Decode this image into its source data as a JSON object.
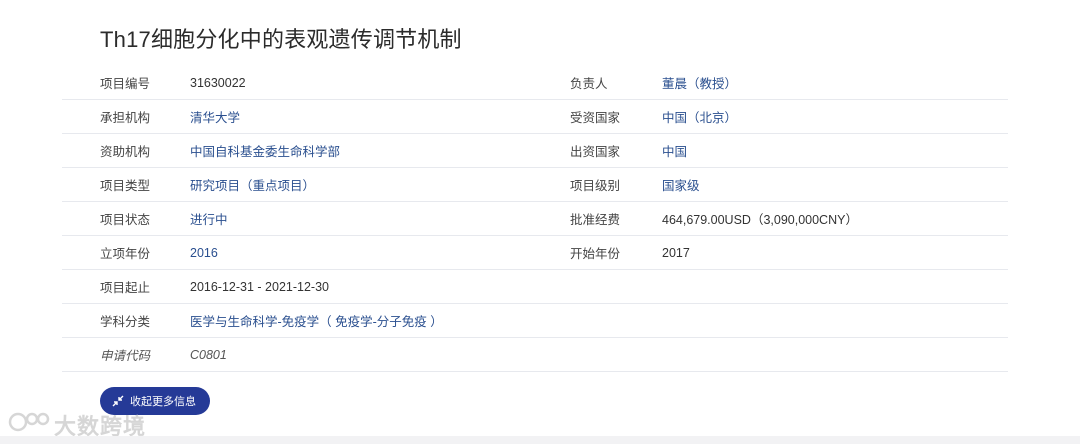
{
  "title": "Th17细胞分化中的表观遗传调节机制",
  "rows": [
    {
      "l1": "项目编号",
      "v1": "31630022",
      "l2": "负责人",
      "v2": "董晨（教授）"
    },
    {
      "l1": "承担机构",
      "v1": "清华大学",
      "l2": "受资国家",
      "v2": "中国（北京）"
    },
    {
      "l1": "资助机构",
      "v1": "中国自科基金委生命科学部",
      "l2": "出资国家",
      "v2": "中国"
    },
    {
      "l1": "项目类型",
      "v1": "研究项目（重点项目）",
      "l2": "项目级别",
      "v2": "国家级"
    },
    {
      "l1": "项目状态",
      "v1": "进行中",
      "l2": "批准经费",
      "v2": "464,679.00USD（3,090,000CNY）"
    },
    {
      "l1": "立项年份",
      "v1": "2016",
      "l2": "开始年份",
      "v2": "2017"
    },
    {
      "l1": "项目起止",
      "v1": "2016-12-31 - 2021-12-30"
    },
    {
      "l1": "学科分类",
      "v1": "医学与生命科学-免疫学（ 免疫学-分子免疫 ）"
    },
    {
      "l1": "申请代码",
      "v1": "C0801"
    }
  ],
  "button": {
    "label": "收起更多信息",
    "icon": "collapse-arrows-icon"
  },
  "watermark": {
    "text": "大数跨境"
  },
  "colors": {
    "accent": "#253a97",
    "link": "#2a4f8f"
  }
}
